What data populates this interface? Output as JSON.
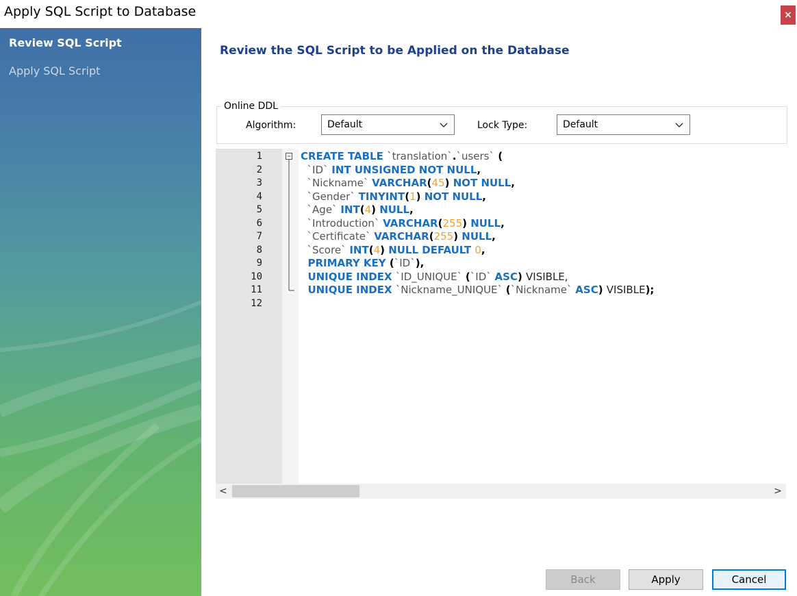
{
  "window": {
    "title": "Apply SQL Script to Database",
    "close_label": "×"
  },
  "sidebar": {
    "steps": [
      {
        "label": "Review SQL Script",
        "active": true
      },
      {
        "label": "Apply SQL Script",
        "active": false
      }
    ]
  },
  "page": {
    "heading": "Review the SQL Script to be Applied on the Database"
  },
  "online_ddl": {
    "legend": "Online DDL",
    "algorithm_label": "Algorithm:",
    "algorithm_value": "Default",
    "lock_type_label": "Lock Type:",
    "lock_type_value": "Default"
  },
  "editor": {
    "line_numbers": [
      "1",
      "2",
      "3",
      "4",
      "5",
      "6",
      "7",
      "8",
      "9",
      "10",
      "11",
      "12"
    ],
    "lines": [
      [
        [
          "kw",
          "CREATE TABLE "
        ],
        [
          "id",
          "`translation`"
        ],
        [
          "pc",
          "."
        ],
        [
          "id",
          "`users`"
        ],
        [
          "pc",
          " ("
        ]
      ],
      [
        [
          "id",
          "  `ID` "
        ],
        [
          "kw",
          "INT UNSIGNED NOT NULL"
        ],
        [
          "pc",
          ","
        ]
      ],
      [
        [
          "id",
          "  `Nickname` "
        ],
        [
          "kw",
          "VARCHAR"
        ],
        [
          "pc",
          "("
        ],
        [
          "num",
          "45"
        ],
        [
          "pc",
          ") "
        ],
        [
          "kw",
          "NOT NULL"
        ],
        [
          "pc",
          ","
        ]
      ],
      [
        [
          "id",
          "  `Gender` "
        ],
        [
          "kw",
          "TINYINT"
        ],
        [
          "pc",
          "("
        ],
        [
          "num",
          "1"
        ],
        [
          "pc",
          ") "
        ],
        [
          "kw",
          "NOT NULL"
        ],
        [
          "pc",
          ","
        ]
      ],
      [
        [
          "id",
          "  `Age` "
        ],
        [
          "kw",
          "INT"
        ],
        [
          "pc",
          "("
        ],
        [
          "num",
          "4"
        ],
        [
          "pc",
          ") "
        ],
        [
          "kw",
          "NULL"
        ],
        [
          "pc",
          ","
        ]
      ],
      [
        [
          "id",
          "  `Introduction` "
        ],
        [
          "kw",
          "VARCHAR"
        ],
        [
          "pc",
          "("
        ],
        [
          "num",
          "255"
        ],
        [
          "pc",
          ") "
        ],
        [
          "kw",
          "NULL"
        ],
        [
          "pc",
          ","
        ]
      ],
      [
        [
          "id",
          "  `Certificate` "
        ],
        [
          "kw",
          "VARCHAR"
        ],
        [
          "pc",
          "("
        ],
        [
          "num",
          "255"
        ],
        [
          "pc",
          ") "
        ],
        [
          "kw",
          "NULL"
        ],
        [
          "pc",
          ","
        ]
      ],
      [
        [
          "id",
          "  `Score` "
        ],
        [
          "kw",
          "INT"
        ],
        [
          "pc",
          "("
        ],
        [
          "num",
          "4"
        ],
        [
          "pc",
          ") "
        ],
        [
          "kw",
          "NULL DEFAULT "
        ],
        [
          "num",
          "0"
        ],
        [
          "pc",
          ","
        ]
      ],
      [
        [
          "kw",
          "  PRIMARY KEY "
        ],
        [
          "pc",
          "("
        ],
        [
          "id",
          "`ID`"
        ],
        [
          "pc",
          "),"
        ]
      ],
      [
        [
          "kw",
          "  UNIQUE INDEX "
        ],
        [
          "id",
          "`ID_UNIQUE` "
        ],
        [
          "pc",
          "("
        ],
        [
          "id",
          "`ID` "
        ],
        [
          "kw",
          "ASC"
        ],
        [
          "pc",
          ") "
        ],
        [
          "plain",
          "VISIBLE,"
        ]
      ],
      [
        [
          "kw",
          "  UNIQUE INDEX "
        ],
        [
          "id",
          "`Nickname_UNIQUE` "
        ],
        [
          "pc",
          "("
        ],
        [
          "id",
          "`Nickname` "
        ],
        [
          "kw",
          "ASC"
        ],
        [
          "pc",
          ") "
        ],
        [
          "plain",
          "VISIBLE"
        ],
        [
          "pc",
          ");"
        ]
      ],
      []
    ]
  },
  "scrollbar": {
    "left_arrow": "<",
    "right_arrow": ">"
  },
  "buttons": {
    "back": "Back",
    "apply": "Apply",
    "cancel": "Cancel"
  }
}
